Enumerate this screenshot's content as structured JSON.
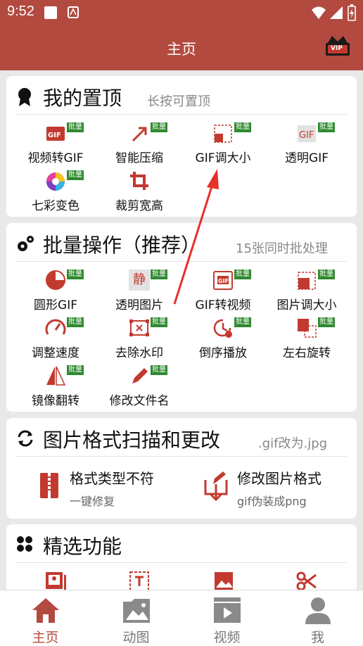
{
  "status": {
    "time": "9:52"
  },
  "appbar": {
    "title": "主页",
    "vip_label": "VIP"
  },
  "pinned": {
    "title": "我的置顶",
    "subtitle": "长按可置顶",
    "items": [
      {
        "label": "视频转GIF",
        "icon": "video-to-gif-icon",
        "badge": "批量"
      },
      {
        "label": "智能压缩",
        "icon": "compress-icon",
        "badge": "批量"
      },
      {
        "label": "GIF调大小",
        "icon": "resize-icon",
        "badge": "批量"
      },
      {
        "label": "透明GIF",
        "icon": "transparent-gif-icon",
        "badge": "批量"
      },
      {
        "label": "七彩变色",
        "icon": "color-wheel-icon",
        "badge": "批量"
      },
      {
        "label": "裁剪宽高",
        "icon": "crop-icon",
        "badge": ""
      }
    ]
  },
  "batch": {
    "title": "批量操作（推荐）",
    "subtitle": "15张同时批处理",
    "items": [
      {
        "label": "圆形GIF",
        "icon": "circle-gif-icon",
        "badge": "批量"
      },
      {
        "label": "透明图片",
        "icon": "transparent-image-icon",
        "badge": "批量",
        "glyph": "静"
      },
      {
        "label": "GIF转视频",
        "icon": "gif-to-video-icon",
        "badge": "批量"
      },
      {
        "label": "图片调大小",
        "icon": "image-resize-icon",
        "badge": "批量"
      },
      {
        "label": "调整速度",
        "icon": "speed-icon",
        "badge": "批量"
      },
      {
        "label": "去除水印",
        "icon": "remove-watermark-icon",
        "badge": "批量"
      },
      {
        "label": "倒序播放",
        "icon": "reverse-play-icon",
        "badge": "批量"
      },
      {
        "label": "左右旋转",
        "icon": "rotate-icon",
        "badge": "批量"
      },
      {
        "label": "镜像翻转",
        "icon": "mirror-icon",
        "badge": "批量"
      },
      {
        "label": "修改文件名",
        "icon": "rename-icon",
        "badge": "批量"
      }
    ]
  },
  "format": {
    "title": "图片格式扫描和更改",
    "subtitle": ".gif改为.jpg",
    "items": [
      {
        "title": "格式类型不符",
        "subtitle": "一键修复",
        "icon": "format-fix-icon"
      },
      {
        "title": "修改图片格式",
        "subtitle": "gif伪装成png",
        "icon": "change-format-icon"
      }
    ]
  },
  "featured": {
    "title": "精选功能",
    "icons": [
      "gallery-icon",
      "text-icon",
      "image-icon",
      "scissors-icon"
    ]
  },
  "tabs": [
    {
      "label": "主页",
      "icon": "home-icon",
      "active": true
    },
    {
      "label": "动图",
      "icon": "animated-image-icon",
      "active": false
    },
    {
      "label": "视频",
      "icon": "video-icon",
      "active": false
    },
    {
      "label": "我",
      "icon": "profile-icon",
      "active": false
    }
  ],
  "colors": {
    "primary": "#b34a40",
    "badge": "#2f8a2f",
    "background": "#e9e9e9"
  }
}
